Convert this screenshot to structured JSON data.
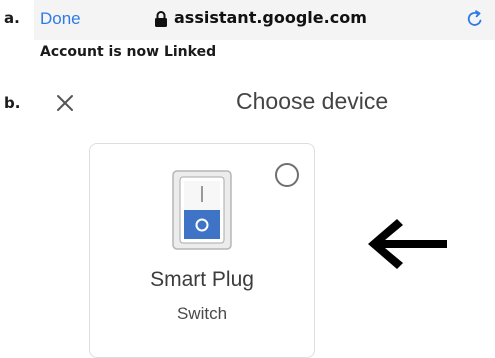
{
  "steps": {
    "a": "a.",
    "b": "b."
  },
  "browser": {
    "done_label": "Done",
    "url": "assistant.google.com",
    "lock_icon": "lock-icon",
    "reload_icon": "reload-icon"
  },
  "status_message": "Account is now Linked",
  "dialog": {
    "title": "Choose device",
    "close_icon": "close-icon"
  },
  "device": {
    "name": "Smart Plug",
    "type": "Switch",
    "icon": "switch-icon",
    "selected": false
  },
  "colors": {
    "link": "#2f7be5",
    "switch_blue": "#3f73c5"
  }
}
